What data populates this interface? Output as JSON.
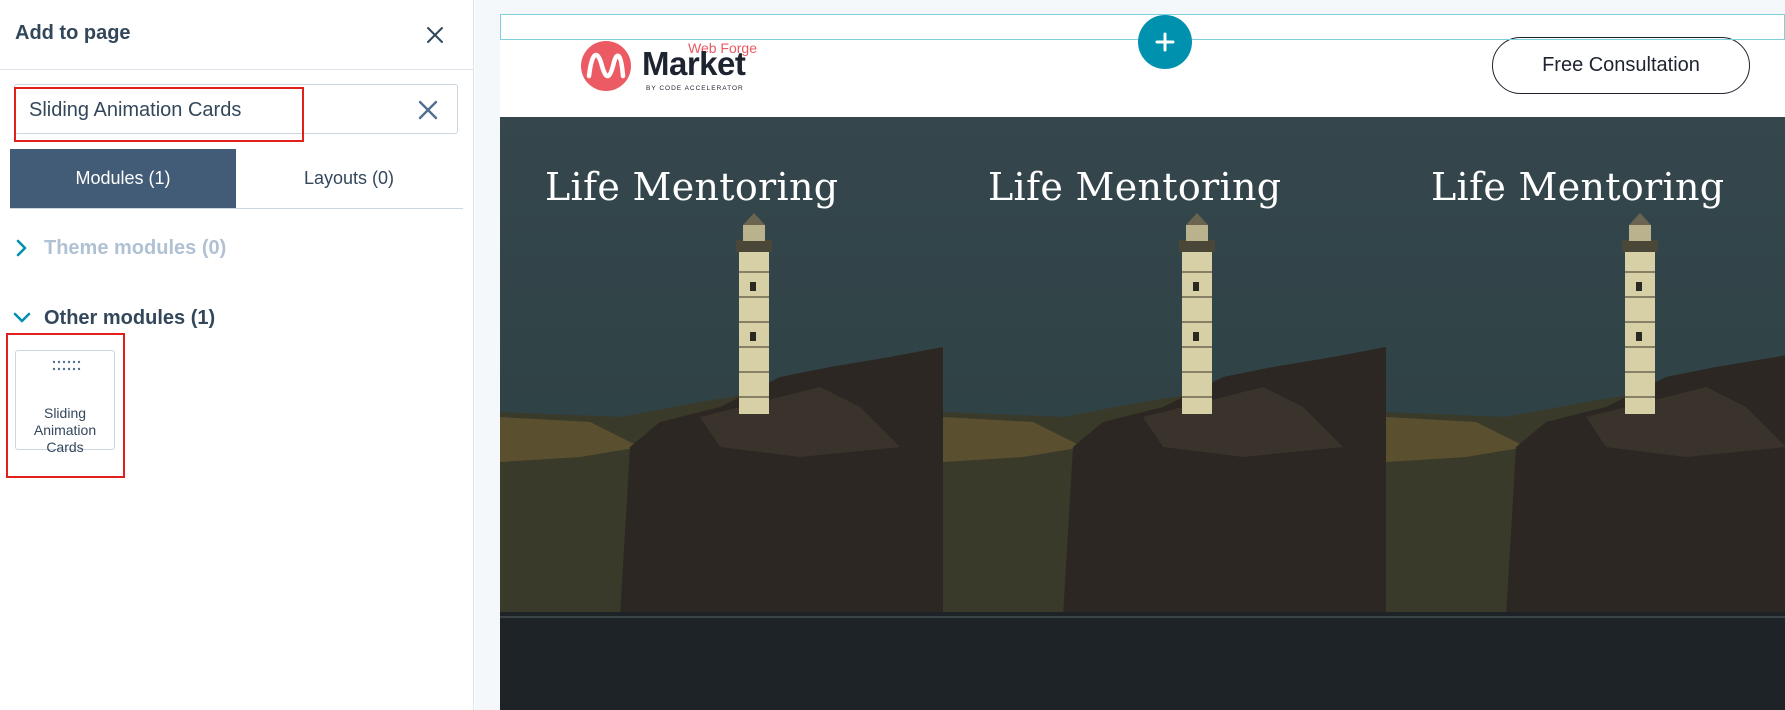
{
  "panel": {
    "title": "Add to page",
    "search_value": "Sliding Animation Cards",
    "tabs": [
      {
        "label": "Modules (1)",
        "active": true
      },
      {
        "label": "Layouts (0)",
        "active": false
      }
    ],
    "sections": [
      {
        "label": "Theme modules (0)",
        "expanded": false
      },
      {
        "label": "Other modules (1)",
        "expanded": true
      }
    ],
    "modules": [
      {
        "label": "Sliding Animation Cards"
      }
    ]
  },
  "preview": {
    "logo": {
      "top": "Web Forge",
      "name": "Market",
      "sub": "BY CODE ACCELERATOR"
    },
    "cta_label": "Free Consultation",
    "cards": [
      {
        "title": "Life Mentoring"
      },
      {
        "title": "Life Mentoring"
      },
      {
        "title": "Life Mentoring"
      }
    ]
  },
  "colors": {
    "primary_tab": "#425b76",
    "accent": "#0091ae",
    "highlight": "#e0201b",
    "logo_red": "#ec5a63"
  },
  "icons": [
    "close-icon",
    "clear-search-icon",
    "chevron-right-icon",
    "chevron-down-icon",
    "drag-grip-icon",
    "plus-icon"
  ]
}
